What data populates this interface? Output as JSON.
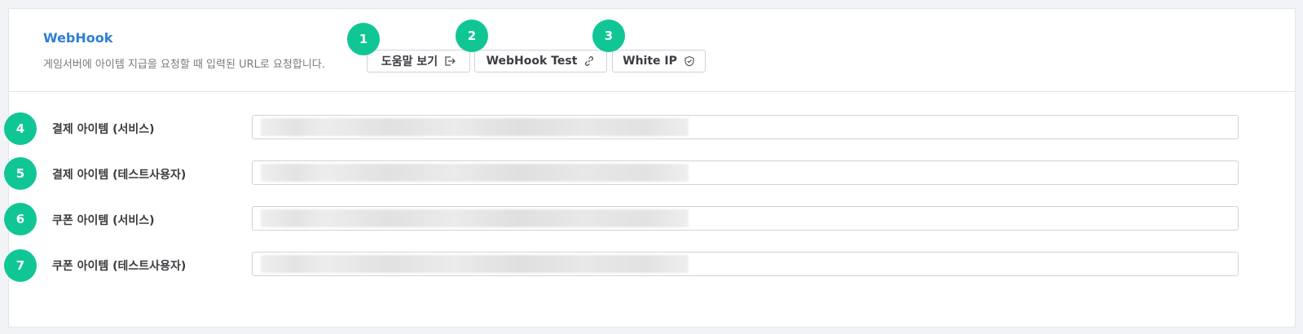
{
  "header": {
    "title": "WebHook",
    "description": "게임서버에 아이템 지급을 요청할 때 입력된 URL로 요청합니다.",
    "buttons": [
      {
        "label": "도움말 보기",
        "icon": "external-link-icon"
      },
      {
        "label": "WebHook Test",
        "icon": "link-icon"
      },
      {
        "label": "White IP",
        "icon": "shield-check-icon"
      }
    ]
  },
  "badges": [
    "1",
    "2",
    "3",
    "4",
    "5",
    "6",
    "7"
  ],
  "fields": [
    {
      "label": "결제 아이템 (서비스)",
      "value": ""
    },
    {
      "label": "결제 아이템 (테스트사용자)",
      "value": ""
    },
    {
      "label": "쿠폰 아이템 (서비스)",
      "value": ""
    },
    {
      "label": "쿠폰 아이템 (테스트사용자)",
      "value": ""
    }
  ],
  "colors": {
    "accent": "#2f7fd3",
    "badge": "#10c694"
  }
}
